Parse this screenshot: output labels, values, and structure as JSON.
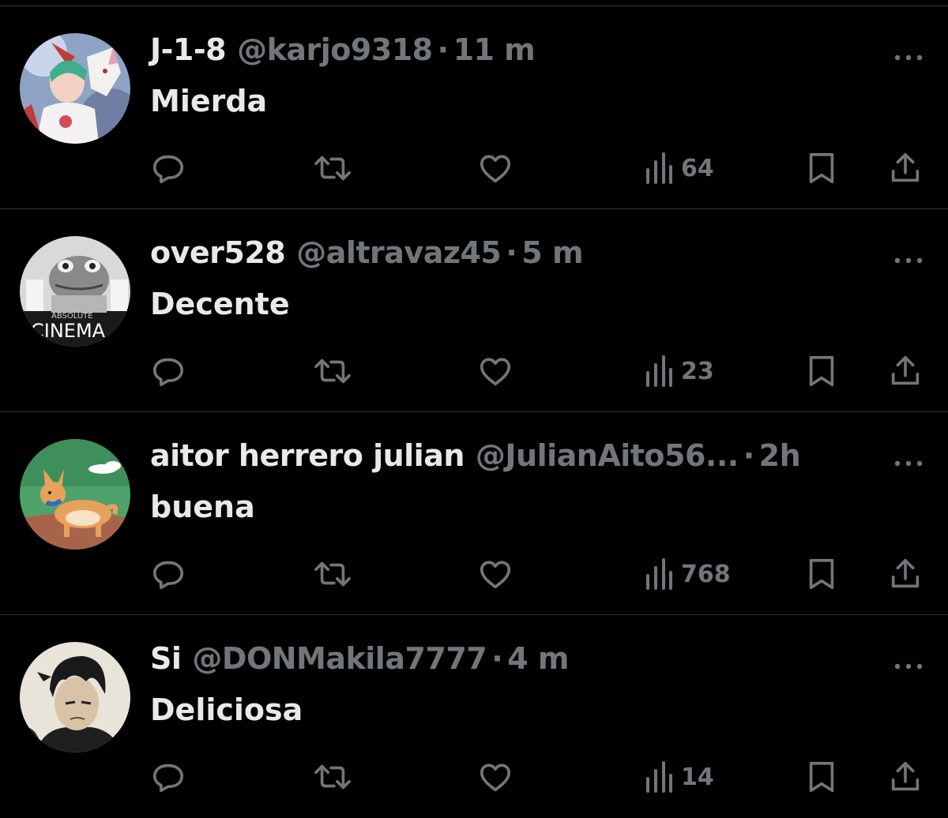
{
  "colors": {
    "background": "#000000",
    "text_primary": "#e7e9ea",
    "text_secondary": "#71767b",
    "divider": "#2f3336"
  },
  "icons": {
    "reply": "speech-bubble-icon",
    "repost": "repost-arrows-icon",
    "like": "heart-icon",
    "views": "bar-chart-icon",
    "bookmark": "bookmark-icon",
    "share": "share-upload-icon",
    "more": "more-horizontal-icon"
  },
  "tweets": [
    {
      "display_name": "J-1-8",
      "handle": "@karjo9318",
      "separator": "·",
      "time": "11 m",
      "text": "Mierda",
      "views": "64"
    },
    {
      "display_name": "over528",
      "handle": "@altravaz45",
      "separator": "·",
      "time": "5 m",
      "text": "Decente",
      "views": "23",
      "avatar_text_small": "ABSOLUTE",
      "avatar_text_large": "CINEMA"
    },
    {
      "display_name": "aitor herrero julian",
      "handle": "@JulianAito56...",
      "separator": "·",
      "time": "2h",
      "text": "buena",
      "views": "768"
    },
    {
      "display_name": "Si",
      "handle": "@DONMakila7777",
      "separator": "·",
      "time": "4 m",
      "text": "Deliciosa",
      "views": "14"
    }
  ]
}
